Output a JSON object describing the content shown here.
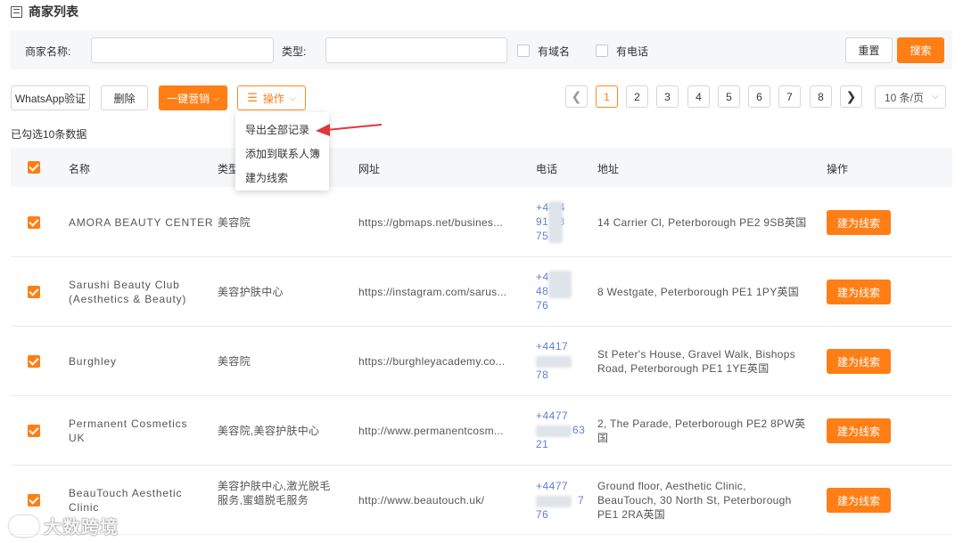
{
  "page": {
    "title": "商家列表",
    "title_icon": "list-icon"
  },
  "filters": {
    "merchant_name_label": "商家名称:",
    "merchant_name_value": "",
    "type_label": "类型:",
    "type_value": "",
    "has_domain_label": "有域名",
    "has_phone_label": "有电话",
    "reset_label": "重置",
    "search_label": "搜索"
  },
  "toolbar": {
    "whatsapp_label": "WhatsApp验证",
    "delete_label": "删除",
    "marketing_label": "一键营销",
    "operation_label": "操作"
  },
  "dropdown": {
    "items": [
      {
        "label": "导出全部记录"
      },
      {
        "label": "添加到联系人簿"
      },
      {
        "label": "建为线索"
      }
    ]
  },
  "pagination": {
    "pages": [
      "1",
      "2",
      "3",
      "4",
      "5",
      "6",
      "7",
      "8"
    ],
    "current": "1",
    "page_size_label": "10 条/页"
  },
  "selection_info": "已勾选10条数据",
  "table": {
    "headers": {
      "name": "名称",
      "type": "类型",
      "website": "网址",
      "phone": "电话",
      "address": "地址",
      "action": "操作"
    },
    "rows": [
      {
        "name": [
          "AMORA BEAUTY CENTER"
        ],
        "type": [
          "美容院"
        ],
        "website": "https://gbmaps.net/busines...",
        "phone": [
          "+44 4",
          "91 93",
          "75"
        ],
        "address": [
          "14 Carrier Cl, Peterborough PE2 9SB英国"
        ],
        "action_label": "建为线索"
      },
      {
        "name": [
          "Sarushi Beauty Club",
          "(Aesthetics & Beauty)"
        ],
        "type": [
          "美容护肤中心"
        ],
        "website": "https://instagram.com/sarus...",
        "phone": [
          "+4 4",
          "48 00",
          "76"
        ],
        "address": [
          "8 Westgate, Peterborough PE1 1PY英国"
        ],
        "action_label": "建为线索"
      },
      {
        "name": [
          "Burghley"
        ],
        "type": [
          "美容院"
        ],
        "website": "https://burghleyacademy.co...",
        "phone": [
          "+4417",
          "",
          "78"
        ],
        "address": [
          "St Peter's House, Gravel Walk, Bishops",
          "Road, Peterborough PE1 1YE英国"
        ],
        "action_label": "建为线索"
      },
      {
        "name": [
          "Permanent Cosmetics",
          "UK"
        ],
        "type": [
          "美容院,美容护肤中心"
        ],
        "website": "http://www.permanentcosm...",
        "phone": [
          "+4477",
          "63",
          "21"
        ],
        "address": [
          "2, The Parade, Peterborough PE2 8PW英",
          "国"
        ],
        "action_label": "建为线索"
      },
      {
        "name": [
          "BeauTouch Aesthetic",
          "Clinic"
        ],
        "type": [
          "美容护肤中心,激光脱毛",
          "服务,蜜蜡脱毛服务"
        ],
        "website": "http://www.beautouch.uk/",
        "phone": [
          "+4477",
          "7",
          "76"
        ],
        "address": [
          "Ground floor, Aesthetic Clinic,",
          "BeauTouch, 30 North St, Peterborough",
          "PE1 2RA英国"
        ],
        "action_label": "建为线索"
      }
    ]
  },
  "watermark": {
    "text": "大数跨境"
  },
  "colors": {
    "accent": "#ff7e15",
    "phone": "#5c7fd6",
    "arrow": "#e0373f",
    "header_bg": "#f6f7f9"
  }
}
